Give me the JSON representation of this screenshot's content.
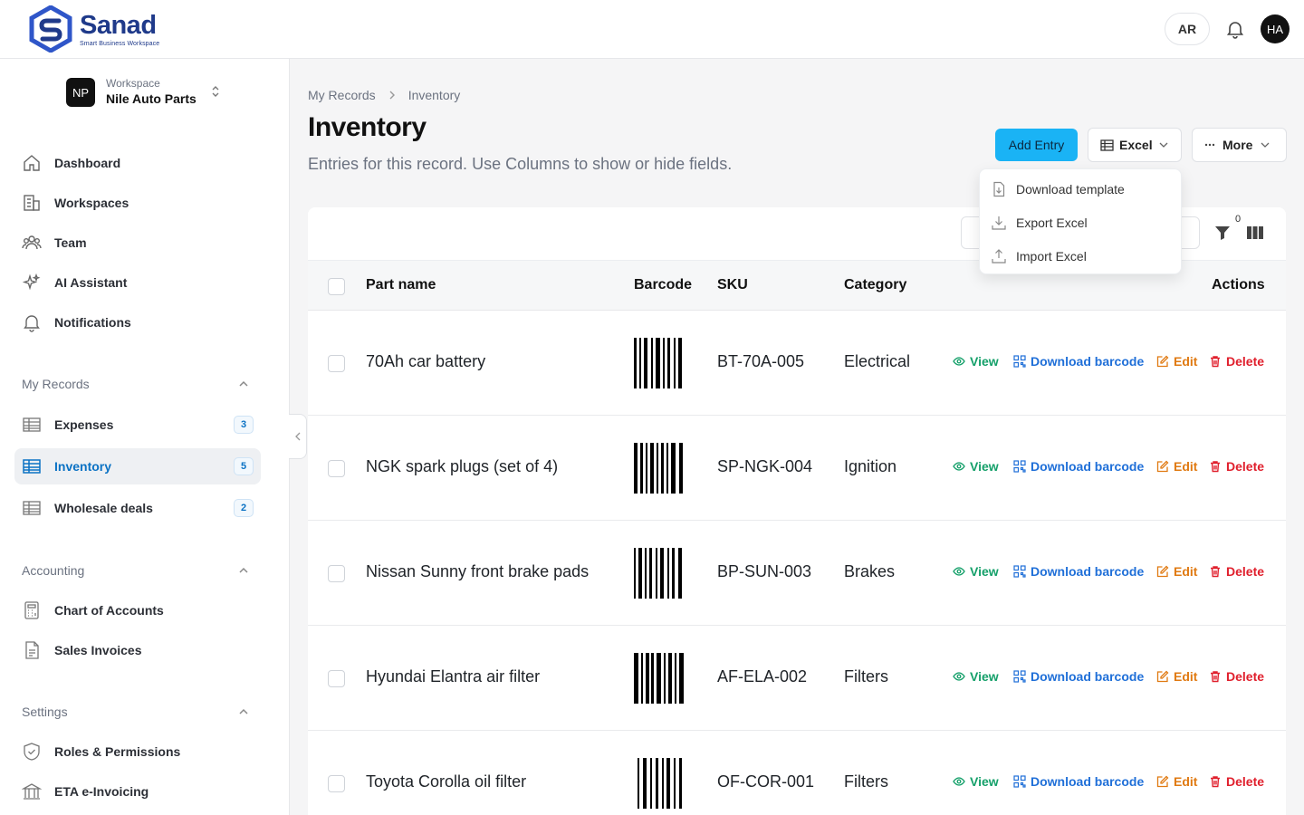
{
  "app": {
    "name": "Sanad",
    "tagline": "Smart Business Workspace",
    "lang_button": "AR",
    "user_initials": "HA"
  },
  "workspace": {
    "label": "Workspace",
    "name": "Nile Auto Parts",
    "initials": "NP"
  },
  "nav": {
    "main": [
      {
        "label": "Dashboard",
        "icon": "home-icon"
      },
      {
        "label": "Workspaces",
        "icon": "building-icon"
      },
      {
        "label": "Team",
        "icon": "team-icon"
      },
      {
        "label": "AI Assistant",
        "icon": "sparkles-icon"
      },
      {
        "label": "Notifications",
        "icon": "bell-icon"
      }
    ],
    "records_heading": "My Records",
    "records": [
      {
        "label": "Expenses",
        "count": "3"
      },
      {
        "label": "Inventory",
        "count": "5",
        "active": true
      },
      {
        "label": "Wholesale deals",
        "count": "2"
      }
    ],
    "accounting_heading": "Accounting",
    "accounting": [
      {
        "label": "Chart of Accounts",
        "icon": "calculator-icon"
      },
      {
        "label": "Sales Invoices",
        "icon": "invoice-icon"
      }
    ],
    "settings_heading": "Settings",
    "settings": [
      {
        "label": "Roles & Permissions",
        "icon": "shield-icon"
      },
      {
        "label": "ETA e-Invoicing",
        "icon": "bank-icon"
      }
    ]
  },
  "breadcrumb": {
    "parent": "My Records",
    "current": "Inventory"
  },
  "page": {
    "title": "Inventory",
    "description": "Entries for this record. Use Columns to show or hide fields."
  },
  "toolbar": {
    "add_label": "Add Entry",
    "excel_label": "Excel",
    "more_label": "More",
    "filter_count": "0"
  },
  "excel_menu": {
    "items": [
      "Download template",
      "Export Excel",
      "Import Excel"
    ]
  },
  "table": {
    "columns": {
      "part_name": "Part name",
      "barcode": "Barcode",
      "sku": "SKU",
      "category": "Category",
      "actions": "Actions"
    },
    "action_labels": {
      "view": "View",
      "download_barcode": "Download barcode",
      "edit": "Edit",
      "delete": "Delete"
    },
    "rows": [
      {
        "part_name": "70Ah car battery",
        "sku": "BT-70A-005",
        "category": "Electrical"
      },
      {
        "part_name": "NGK spark plugs (set of 4)",
        "sku": "SP-NGK-004",
        "category": "Ignition"
      },
      {
        "part_name": "Nissan Sunny front brake pads",
        "sku": "BP-SUN-003",
        "category": "Brakes"
      },
      {
        "part_name": "Hyundai Elantra air filter",
        "sku": "AF-ELA-002",
        "category": "Filters"
      },
      {
        "part_name": "Toyota Corolla oil filter",
        "sku": "OF-COR-001",
        "category": "Filters"
      }
    ]
  },
  "colors": {
    "accent": "#1ab3f5",
    "active_nav": "#0b72c4",
    "view": "#15a06a",
    "download": "#1f6fd8",
    "edit": "#e07a12",
    "delete": "#e0202d"
  }
}
